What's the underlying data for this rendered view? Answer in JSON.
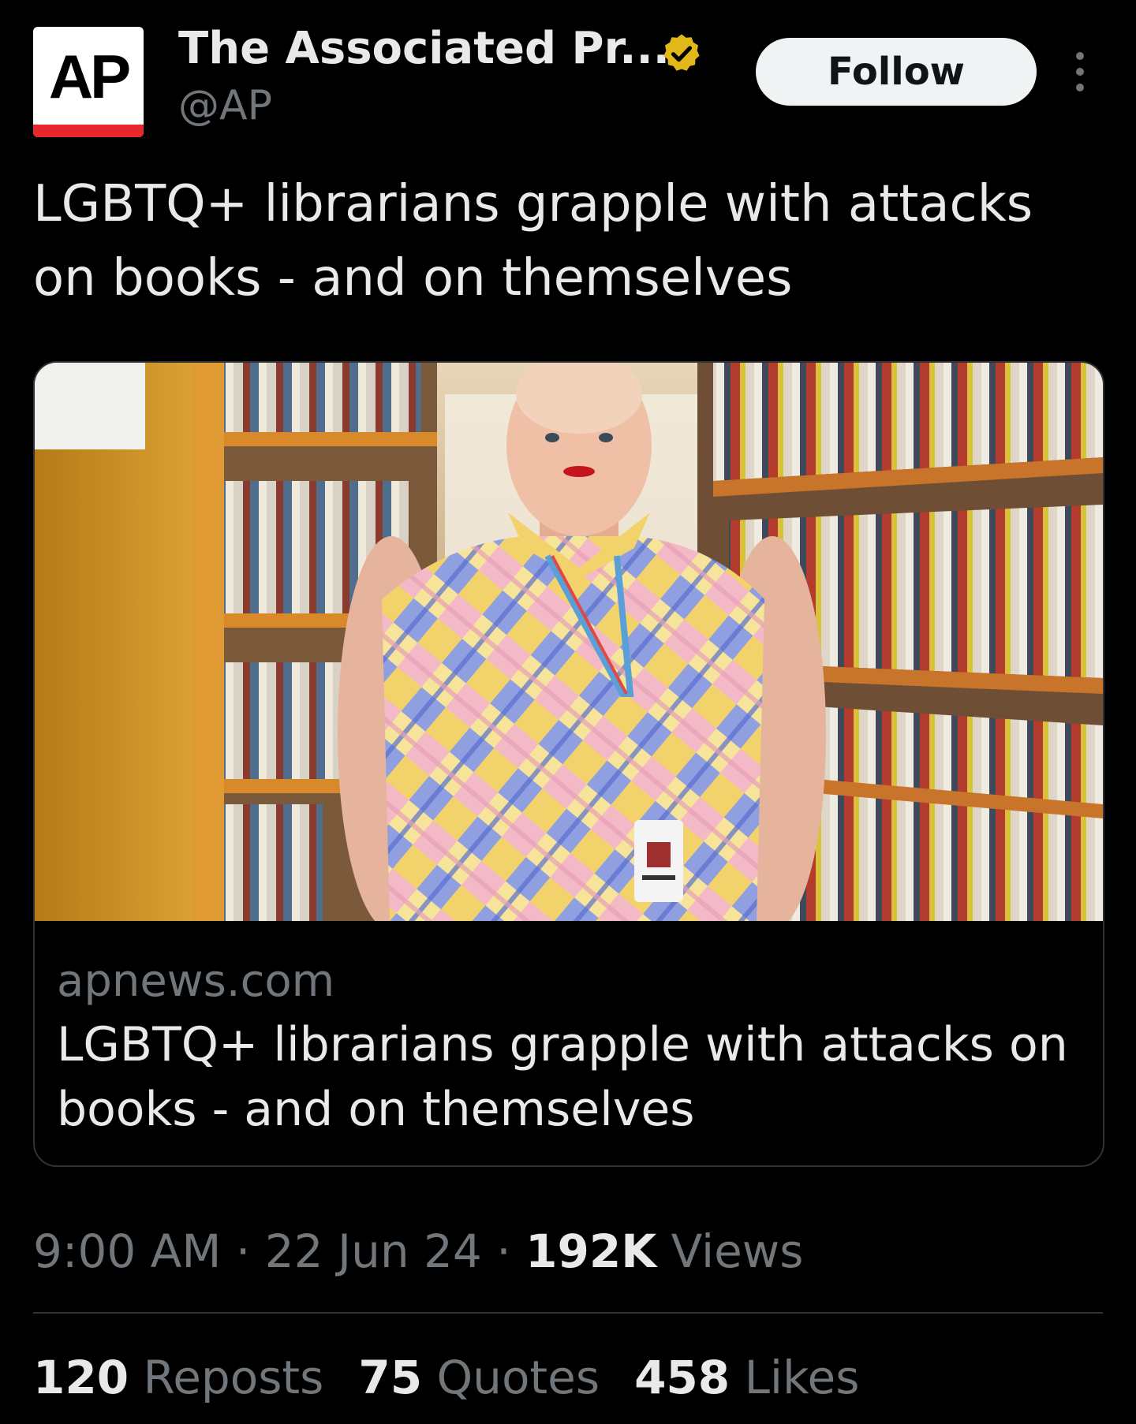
{
  "author": {
    "avatar_text": "AP",
    "display_name": "The Associated Pr...",
    "handle": "@AP",
    "verified_badge": "gold-verified-check-icon"
  },
  "actions": {
    "follow_label": "Follow",
    "more_icon": "more-vertical-icon"
  },
  "tweet": {
    "text": "LGBTQ+ librarians grapple with attacks on books - and on themselves"
  },
  "card": {
    "domain": "apnews.com",
    "title": "LGBTQ+ librarians grapple with attacks on books - and on themselves"
  },
  "meta": {
    "time": "9:00 AM",
    "sep1": " · ",
    "date": "22 Jun 24",
    "sep2": " · ",
    "views_count": "192K",
    "views_label": " Views"
  },
  "stats": {
    "reposts_count": "120",
    "reposts_label": " Reposts",
    "quotes_count": "75",
    "quotes_label": " Quotes",
    "likes_count": "458",
    "likes_label": " Likes"
  },
  "colors": {
    "background": "#000000",
    "text_primary": "#e7e9ea",
    "text_secondary": "#71767b",
    "border": "#2f3336",
    "verified_gold": "#e2b719",
    "ap_red": "#e8262b",
    "follow_bg": "#eff3f4"
  }
}
